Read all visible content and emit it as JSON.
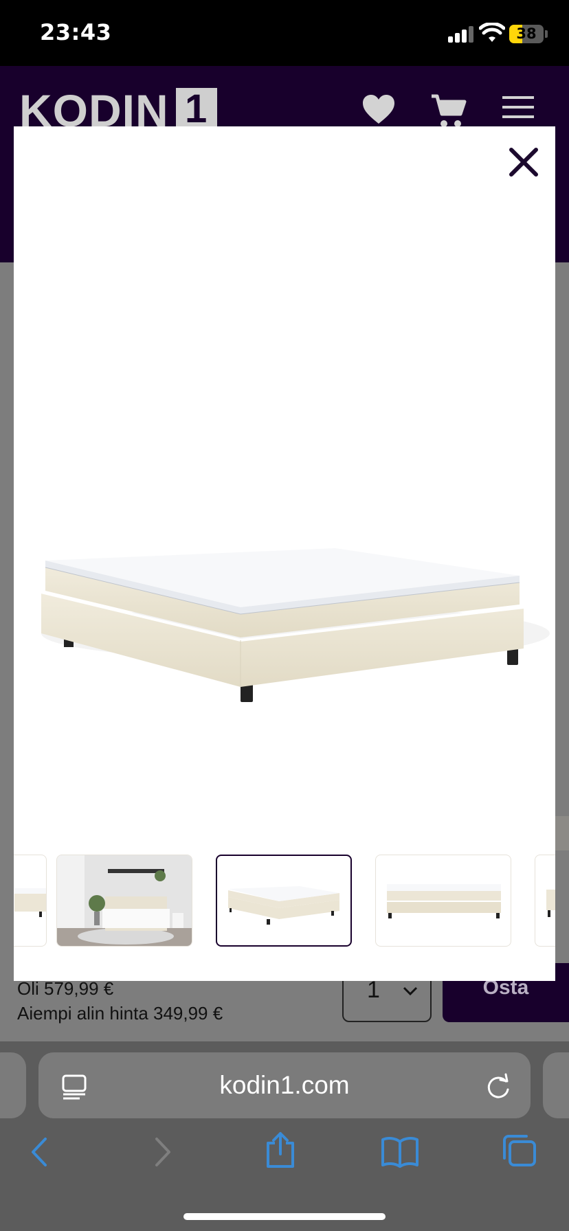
{
  "status_bar": {
    "time": "23:43",
    "battery_level": "38"
  },
  "header": {
    "logo_text": "KODIN",
    "logo_number": "1",
    "icons": [
      "heart-icon",
      "cart-icon",
      "menu-icon"
    ]
  },
  "product": {
    "old_price": "Oli 579,99 €",
    "lowest_price": "Aiempi alin hinta 349,99 €",
    "quantity": "1",
    "buy_label": "Osta"
  },
  "gallery": {
    "close_icon": "close-icon",
    "thumbnails": [
      {
        "name": "bed-partial",
        "selected": false
      },
      {
        "name": "bedroom-scene",
        "selected": false
      },
      {
        "name": "bed-angle",
        "selected": true
      },
      {
        "name": "bed-front",
        "selected": false
      },
      {
        "name": "bed-partial-right",
        "selected": false
      }
    ]
  },
  "browser": {
    "url": "kodin1.com",
    "toolbar": [
      "back-icon",
      "forward-icon",
      "share-icon",
      "bookmarks-icon",
      "tabs-icon"
    ]
  },
  "colors": {
    "brand": "#18002c",
    "status_battery": "#ffd60a",
    "safari_blue": "#3a8bd6"
  }
}
